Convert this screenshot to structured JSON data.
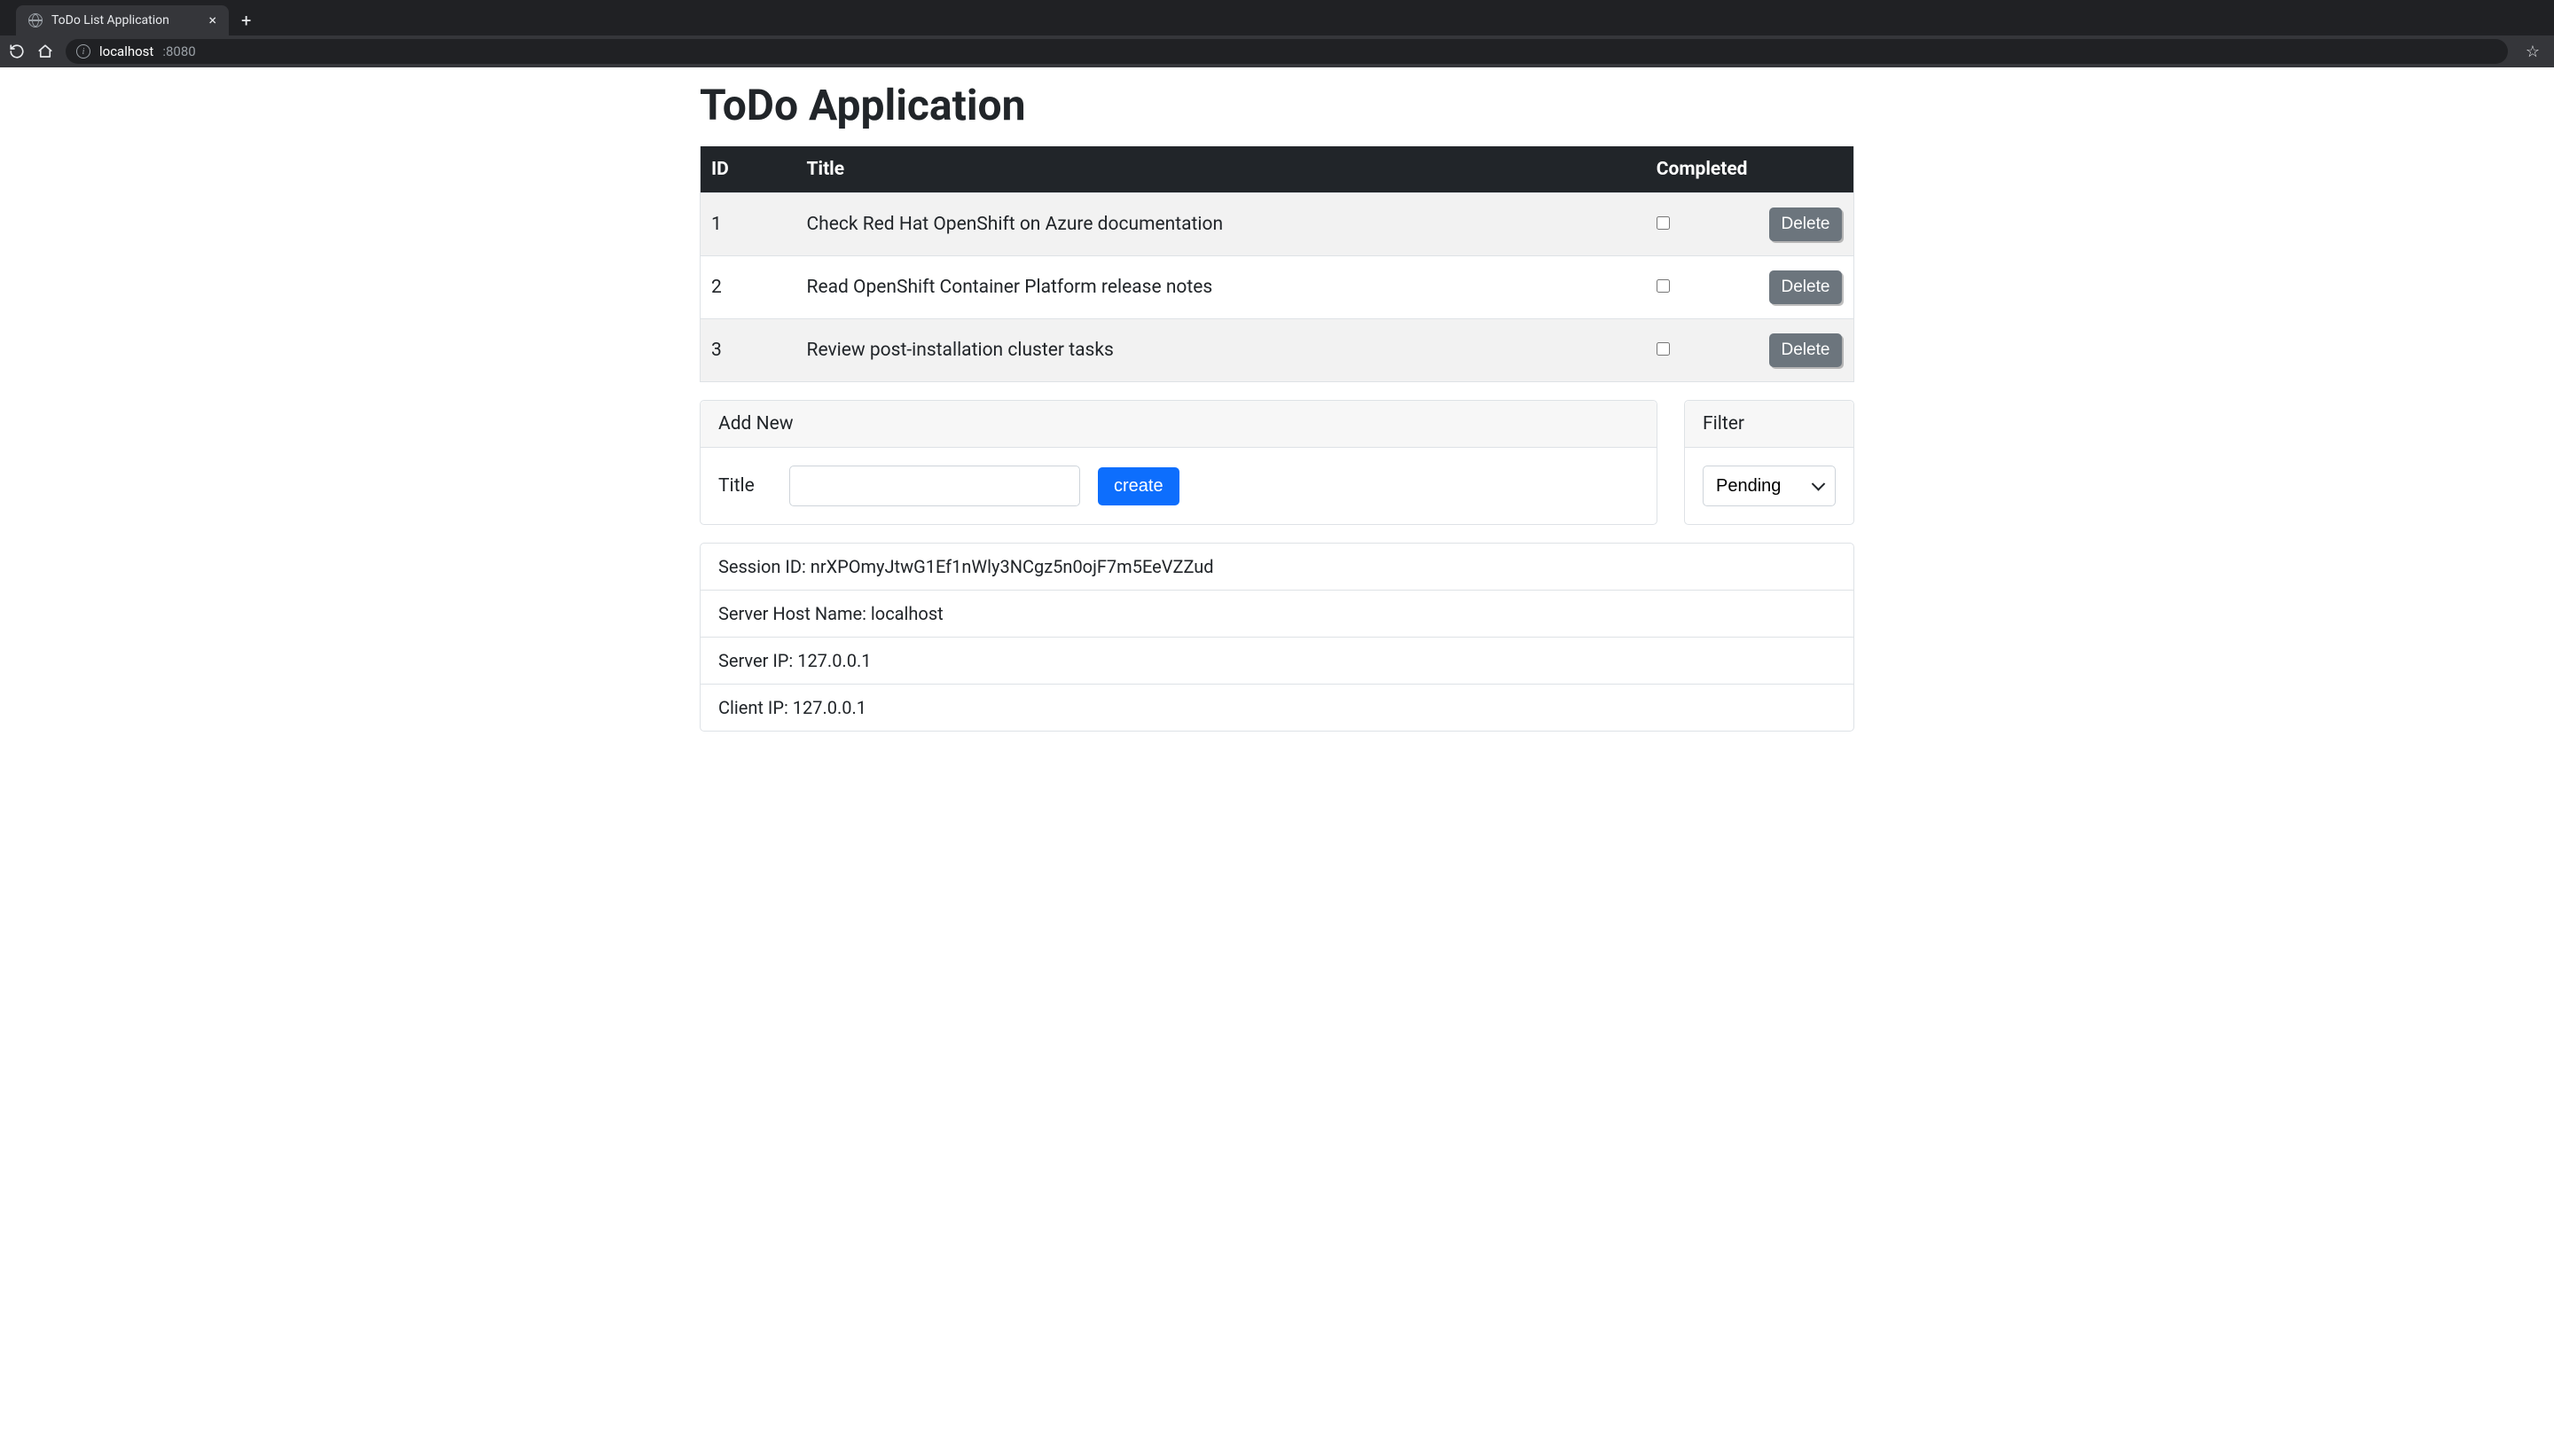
{
  "browser": {
    "tab_title": "ToDo List Application",
    "url_host": "localhost",
    "url_port": ":8080"
  },
  "page": {
    "heading": "ToDo Application"
  },
  "table": {
    "headers": {
      "id": "ID",
      "title": "Title",
      "completed": "Completed"
    },
    "delete_label": "Delete",
    "rows": [
      {
        "id": "1",
        "title": "Check Red Hat OpenShift on Azure documentation",
        "completed": false
      },
      {
        "id": "2",
        "title": "Read OpenShift Container Platform release notes",
        "completed": false
      },
      {
        "id": "3",
        "title": "Review post-installation cluster tasks",
        "completed": false
      }
    ]
  },
  "add_new": {
    "header": "Add New",
    "title_label": "Title",
    "title_value": "",
    "create_label": "create"
  },
  "filter": {
    "header": "Filter",
    "selected": "Pending"
  },
  "info": {
    "session_id": "Session ID: nrXPOmyJtwG1Ef1nWly3NCgz5n0ojF7m5EeVZZud",
    "server_host": "Server Host Name: localhost",
    "server_ip": "Server IP: 127.0.0.1",
    "client_ip": "Client IP: 127.0.0.1"
  }
}
